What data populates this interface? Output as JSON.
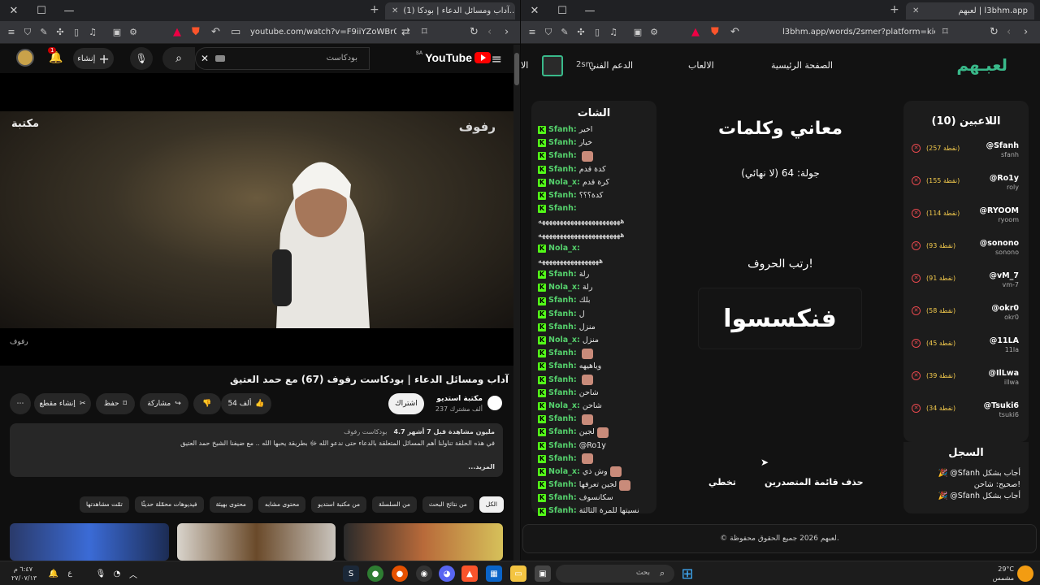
{
  "left_window": {
    "tab_title": "(1) آداب ومسائل الدعاء | بودكا...",
    "url": "youtube.com/watch?v=F9iiYZoWBr0&t=4s",
    "youtube": {
      "logo_text": "YouTube",
      "logo_suffix": "SA",
      "search_value": "بودكاست",
      "create_label": "إنشاء",
      "notif_count": "1",
      "video_watermark_right": "رفوف",
      "video_watermark_left": "مكتبة",
      "video_caption": "رفوف",
      "video_title": "آداب ومسائل الدعاء | بودكاست رفوف (67) مع حمد العتيق",
      "channel_name": "مكتبة استديو",
      "channel_subs": "237 ألف مشترك",
      "subscribe_label": "اشتراك",
      "like_count": "54 ألف",
      "share_label": "مشاركة",
      "save_label": "حفظ",
      "clip_label": "إنشاء مقطع",
      "desc_stats": "4.7 مليون مشاهدة قبل 7 أشهر",
      "desc_tag": "بودكاست رفوف",
      "desc_text": "في هذه الحلقة تناولنا أهم المسائل المتعلقة بالدعاء حتى ندعو الله ﷻ بطريقة يحبها الله .. مع ضيفنا الشيخ حمد العتيق",
      "desc_more": "...المزيد",
      "chips": [
        "الكل",
        "من نتائج البحث",
        "من السلسلة",
        "من مكتبة استديو",
        "محتوى مشابه",
        "محتوى بهيئة",
        "فيديوهات محمّلة حديثًا",
        "تمّت مشاهدتها"
      ]
    }
  },
  "right_window": {
    "tab_title": "لعبهم | l3bhm.app",
    "url": "l3bhm.app/words/2smer?platform=kick",
    "site": {
      "logo": "لعبـهم",
      "nav_home": "الصفحة الرئيسية",
      "nav_games": "الالعاب",
      "nav_support": "الدعم الفني",
      "nav_user": "2sm",
      "nav_more": "الا",
      "chat_title": "الشات",
      "chat": [
        {
          "user": "Sfanh:",
          "msg": "اخير"
        },
        {
          "user": "Sfanh:",
          "msg": "خيار"
        },
        {
          "user": "Sfanh:",
          "msg": "",
          "emote": true
        },
        {
          "user": "Sfanh:",
          "msg": "كدة قدم"
        },
        {
          "user": "Nola_x:",
          "msg": "كرة قدم"
        },
        {
          "user": "Sfanh:",
          "msg": "كدة؟؟؟"
        },
        {
          "user": "Sfanh:",
          "msg": ""
        },
        {
          "user": "",
          "msg": "هههههههههههههههههههههههه"
        },
        {
          "user": "",
          "msg": "هههههههههههههههههههههههه"
        },
        {
          "user": "Nola_x:",
          "msg": ""
        },
        {
          "user": "",
          "msg": "هههههههههههههههههه"
        },
        {
          "user": "Sfanh:",
          "msg": "رلة"
        },
        {
          "user": "Nola_x:",
          "msg": "رلة"
        },
        {
          "user": "Sfanh:",
          "msg": "بلك"
        },
        {
          "user": "Sfanh:",
          "msg": "ل"
        },
        {
          "user": "Sfanh:",
          "msg": "منزل"
        },
        {
          "user": "Nola_x:",
          "msg": "منزل"
        },
        {
          "user": "Sfanh:",
          "msg": "",
          "emote": true
        },
        {
          "user": "Sfanh:",
          "msg": "وياهيهه"
        },
        {
          "user": "Sfanh:",
          "msg": "",
          "emote": true
        },
        {
          "user": "Sfanh:",
          "msg": "شاحن"
        },
        {
          "user": "Nola_x:",
          "msg": "شاحن"
        },
        {
          "user": "Sfanh:",
          "msg": "",
          "emote": true
        },
        {
          "user": "Sfanh:",
          "msg": "لجين",
          "emote": true
        },
        {
          "user": "Sfanh:",
          "msg": "@Ro1y"
        },
        {
          "user": "Sfanh:",
          "msg": "",
          "emote": true
        },
        {
          "user": "Nola_x:",
          "msg": "وش ذي",
          "emote": true
        },
        {
          "user": "Sfanh:",
          "msg": "لجين تعرفها",
          "emote": true
        },
        {
          "user": "Sfanh:",
          "msg": "سكانسوف"
        },
        {
          "user": "Sfanh:",
          "msg": "نسيتها للمرة الثالثة"
        }
      ],
      "game_title": "معاني وكلمات",
      "round": "جولة: 64 (لا نهائي)",
      "prompt": "رتب الحروف!",
      "scrambled_word": "فنكسسوا",
      "btn_clear": "حذف قائمة المتصدرين",
      "btn_skip": "تخطي",
      "players_title": "اللاعبين (10)",
      "players": [
        {
          "name": "@Sfanh",
          "sub": "sfanh",
          "points": "(257 نقطة)"
        },
        {
          "name": "@Ro1y",
          "sub": "roly",
          "points": "(155 نقطة)"
        },
        {
          "name": "@RYOOM",
          "sub": "ryoom",
          "points": "(114 نقطة)"
        },
        {
          "name": "@sonono",
          "sub": "sonono",
          "points": "(93 نقطة)"
        },
        {
          "name": "@vM_7",
          "sub": "vm-7",
          "points": "(91 نقطة)"
        },
        {
          "name": "@okr0",
          "sub": "okr0",
          "points": "(58 نقطة)"
        },
        {
          "name": "@11LA",
          "sub": "11la",
          "points": "(45 نقطة)"
        },
        {
          "name": "@IlLwa",
          "sub": "illwa",
          "points": "(39 نقطة)"
        },
        {
          "name": "@Tsuki6",
          "sub": "tsuki6",
          "points": "(34 نقطة)"
        }
      ],
      "log_title": "السجل",
      "log": [
        "🎉 @Sfanh أجاب بشكل",
        "صحيح: شاحن!",
        "🎉 @Sfanh أجاب بشكل"
      ],
      "footer": "© لعبهم 2026 جميع الحقوق محفوظة."
    }
  },
  "taskbar": {
    "search_placeholder": "بحث",
    "weather_temp": "29°C",
    "weather_desc": "مشمس",
    "time": "٦:٤٧ م",
    "date": "٢٧/٠٧/١٣",
    "lang": "ع"
  }
}
